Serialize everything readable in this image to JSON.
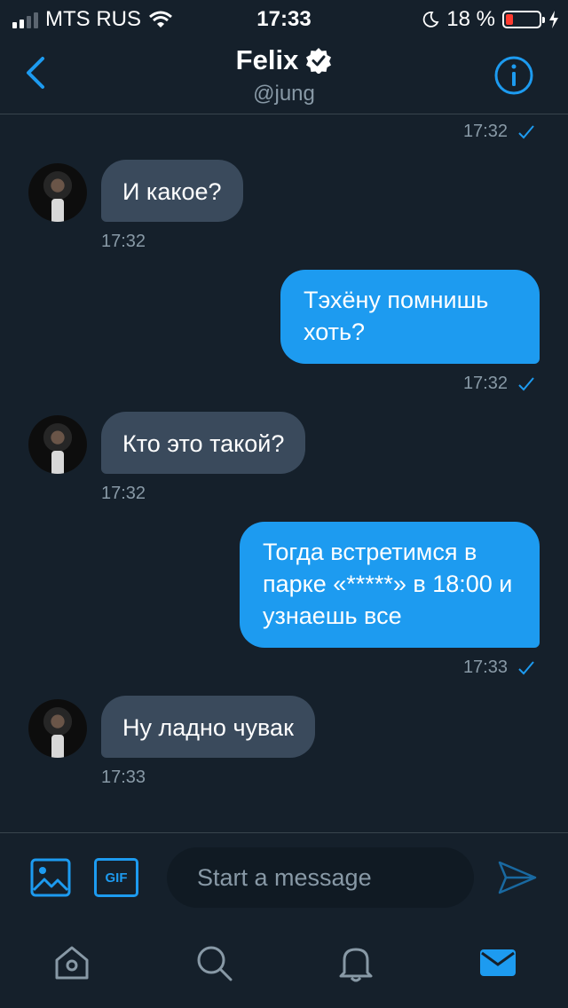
{
  "status_bar": {
    "carrier": "MTS RUS",
    "time": "17:33",
    "battery_percent": "18 %",
    "battery_level": 0.18,
    "signal_bars_on": 2,
    "icons": [
      "signal-icon",
      "wifi-icon",
      "moon-icon",
      "battery-icon",
      "charging-icon"
    ]
  },
  "header": {
    "title": "Felix",
    "handle": "@jung",
    "icons": [
      "back-icon",
      "verified-icon",
      "info-icon"
    ]
  },
  "messages": [
    {
      "direction": "out",
      "text": "",
      "time": "17:32",
      "read": true
    },
    {
      "direction": "in",
      "text": "И какое?",
      "time": "17:32"
    },
    {
      "direction": "out",
      "text": "Тэхёну помнишь хоть?",
      "time": "17:32",
      "read": true
    },
    {
      "direction": "in",
      "text": "Кто это такой?",
      "time": "17:32"
    },
    {
      "direction": "out",
      "text": "Тогда встретимся в парке «*****» в 18:00 и узнаешь все",
      "time": "17:33",
      "read": true
    },
    {
      "direction": "in",
      "text": "Ну ладно чувак",
      "time": "17:33"
    }
  ],
  "composer": {
    "placeholder": "Start a message",
    "gif_label": "GIF",
    "icons": [
      "image-icon",
      "gif-icon",
      "send-icon"
    ]
  },
  "tab_bar": {
    "tabs": [
      "home",
      "search",
      "notifications",
      "messages"
    ],
    "active": "messages"
  },
  "colors": {
    "background": "#15202b",
    "accent": "#1d9bf0",
    "incoming_bubble": "#3a4a5c",
    "muted_text": "#8899a6",
    "battery_low": "#ff3b30"
  }
}
